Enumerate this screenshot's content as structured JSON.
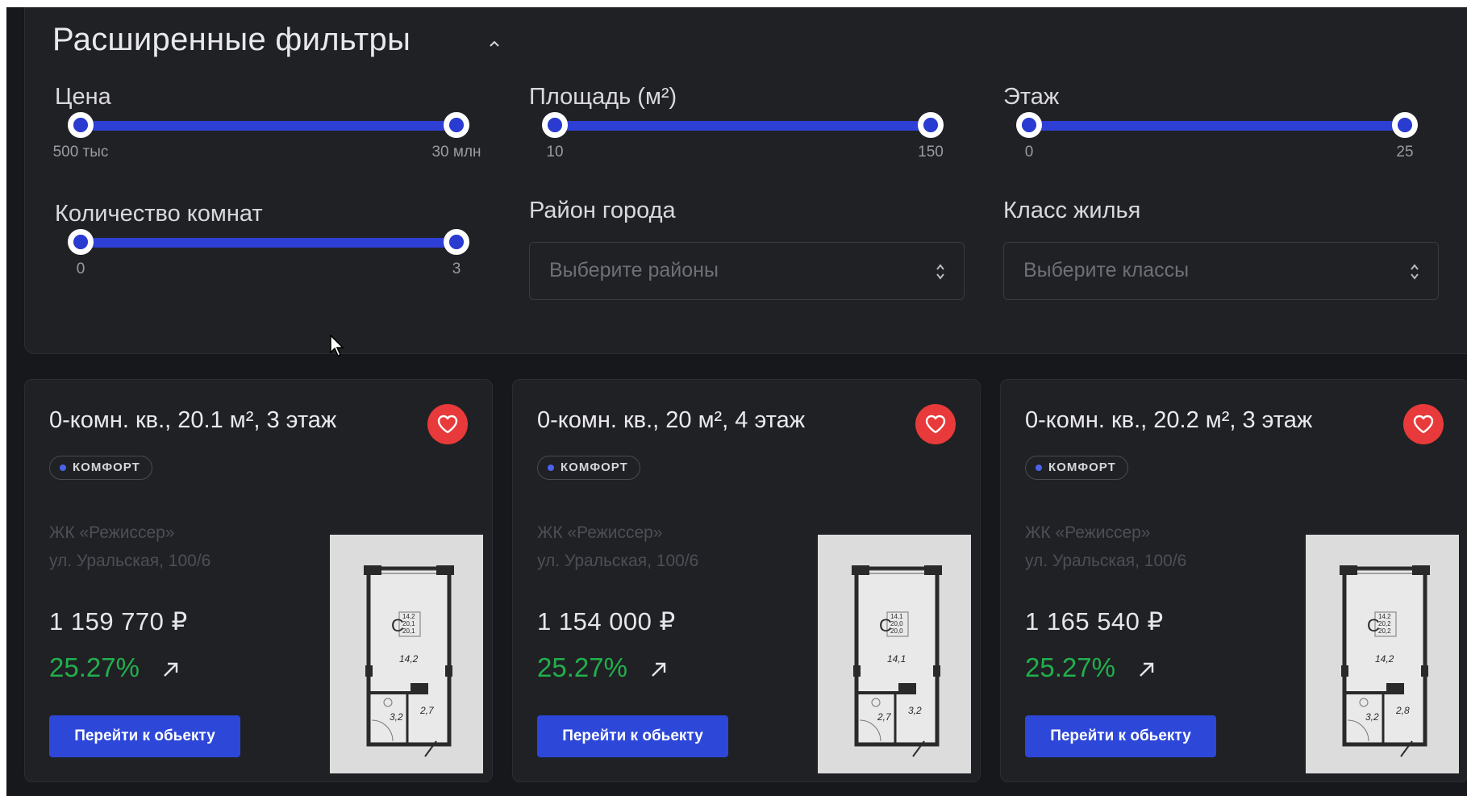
{
  "filters": {
    "title": "Расширенные фильтры",
    "price": {
      "label": "Цена",
      "min_label": "500 тыс",
      "max_label": "30 млн",
      "range_fraction": [
        0,
        1
      ]
    },
    "area": {
      "label": "Площадь (м²)",
      "min_label": "10",
      "max_label": "150",
      "range_fraction": [
        0,
        1
      ]
    },
    "floor": {
      "label": "Этаж",
      "min_label": "0",
      "max_label": "25",
      "range_fraction": [
        0,
        1
      ]
    },
    "rooms": {
      "label": "Количество комнат",
      "min_label": "0",
      "max_label": "3",
      "range_fraction": [
        0,
        1
      ]
    },
    "district": {
      "label": "Район города",
      "placeholder": "Выберите районы"
    },
    "housing_class": {
      "label": "Класс жилья",
      "placeholder": "Выберите классы"
    }
  },
  "listings": [
    {
      "title": "0-комн. кв., 20.1 м², 3 этаж",
      "badge": "КОМФОРТ",
      "complex": "ЖК «Режиссер»",
      "address": "ул. Уральская, 100/6",
      "price": "1 159 770 ₽",
      "percent": "25.27%",
      "button": "Перейти к обьекту",
      "plan_labels": [
        "С",
        "14,2",
        "20,1",
        "20,1",
        "14,2",
        "3,2",
        "2,7"
      ]
    },
    {
      "title": "0-комн. кв., 20 м², 4 этаж",
      "badge": "КОМФОРТ",
      "complex": "ЖК «Режиссер»",
      "address": "ул. Уральская, 100/6",
      "price": "1 154 000 ₽",
      "percent": "25.27%",
      "button": "Перейти к обьекту",
      "plan_labels": [
        "С",
        "14,1",
        "20,0",
        "20,0",
        "14,1",
        "2,7",
        "3,2"
      ]
    },
    {
      "title": "0-комн. кв., 20.2 м², 3 этаж",
      "badge": "КОМФОРТ",
      "complex": "ЖК «Режиссер»",
      "address": "ул. Уральская, 100/6",
      "price": "1 165 540 ₽",
      "percent": "25.27%",
      "button": "Перейти к обьекту",
      "plan_labels": [
        "С",
        "14,2",
        "20,2",
        "20,2",
        "14,2",
        "3,2",
        "2,8"
      ]
    }
  ],
  "colors": {
    "background": "#17181b",
    "panel": "#202125",
    "accent": "#2d47d8",
    "favorite": "#e83a3a",
    "growth": "#21b04b"
  },
  "icons": [
    "chevron-up-icon",
    "sort-icon",
    "heart-icon",
    "arrow-up-right-icon",
    "cursor-icon"
  ]
}
